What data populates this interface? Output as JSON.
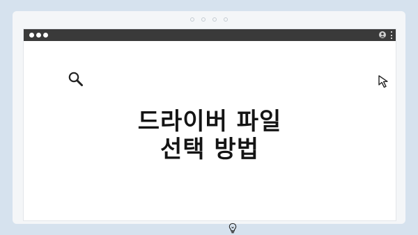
{
  "slide": {
    "headline_line1": "드라이버 파일",
    "headline_line2": "선택 방법"
  },
  "icons": {
    "window_dots": "window-dot-icon",
    "user": "user-icon",
    "menu": "kebab-menu-icon",
    "search": "search-icon",
    "cursor": "cursor-arrow-icon",
    "lightbulb": "lightbulb-icon"
  },
  "colors": {
    "background": "#d6e2ee",
    "titlebar": "#3a3a3a",
    "text": "#141414"
  }
}
